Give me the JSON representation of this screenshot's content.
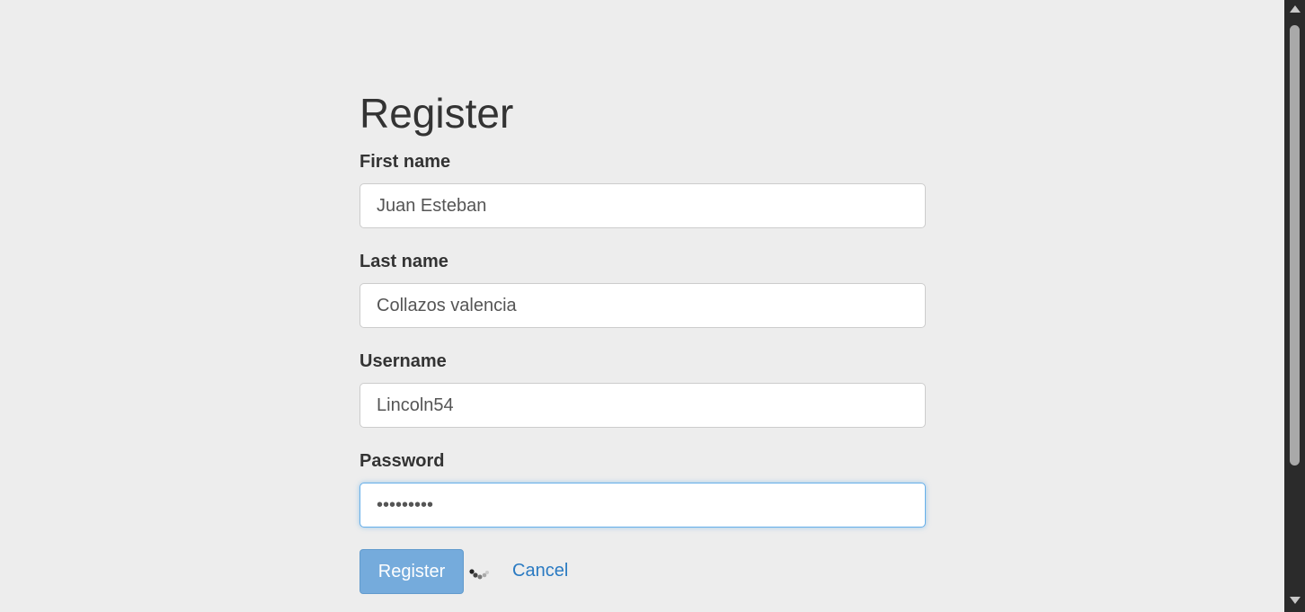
{
  "form": {
    "title": "Register",
    "first_name": {
      "label": "First name",
      "value": "Juan Esteban"
    },
    "last_name": {
      "label": "Last name",
      "value": "Collazos valencia"
    },
    "username": {
      "label": "Username",
      "value": "Lincoln54"
    },
    "password": {
      "label": "Password",
      "value": "•••••••••"
    },
    "register_button": "Register",
    "cancel_link": "Cancel",
    "loading_icon": "spinner-icon"
  },
  "colors": {
    "background": "#ededed",
    "primary_button": "#6fa8dc",
    "link": "#2a7ac2",
    "focus_border": "#66afe9",
    "scrollbar_track": "#2b2b2b",
    "scrollbar_thumb": "#a9a9a9"
  },
  "scrollbar": {
    "icons": [
      "scroll-up-arrow-icon",
      "scroll-down-arrow-icon"
    ]
  }
}
